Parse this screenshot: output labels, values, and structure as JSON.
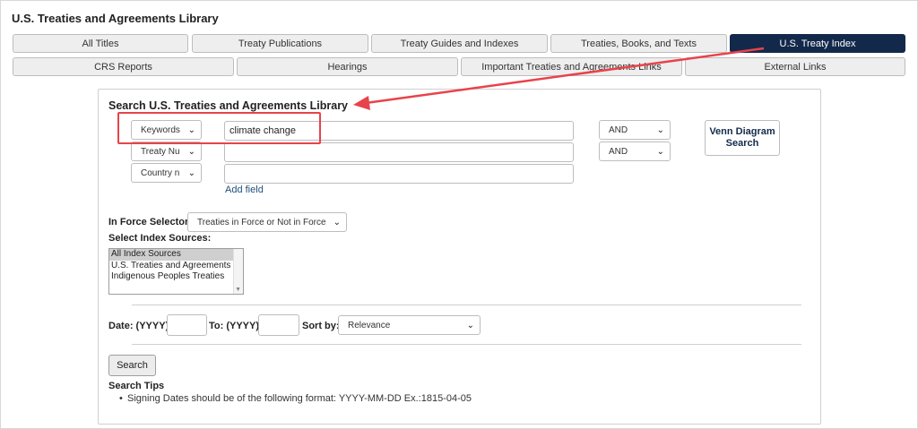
{
  "library_title": "U.S. Treaties and Agreements Library",
  "tabs_row1": [
    {
      "label": "All Titles",
      "active": false
    },
    {
      "label": "Treaty Publications",
      "active": false
    },
    {
      "label": "Treaty Guides and Indexes",
      "active": false
    },
    {
      "label": "Treaties, Books, and Texts",
      "active": false
    },
    {
      "label": "U.S. Treaty Index",
      "active": true
    }
  ],
  "tabs_row2": [
    {
      "label": "CRS Reports"
    },
    {
      "label": "Hearings"
    },
    {
      "label": "Important Treaties and Agreements Links"
    },
    {
      "label": "External Links"
    }
  ],
  "search": {
    "title": "Search U.S. Treaties and Agreements Library",
    "rows": [
      {
        "field": "Keywords",
        "value": "climate change",
        "operator": "AND"
      },
      {
        "field": "Treaty Nu",
        "value": "",
        "operator": "AND"
      },
      {
        "field": "Country n",
        "value": ""
      }
    ],
    "add_field_label": "Add field",
    "venn_button_label": "Venn Diagram Search",
    "in_force_label": "In Force Selector:",
    "in_force_value": "Treaties in Force or Not in Force",
    "index_sources_label": "Select Index Sources:",
    "index_sources": [
      {
        "label": "All Index Sources",
        "selected": true
      },
      {
        "label": "U.S. Treaties and Agreements",
        "selected": false
      },
      {
        "label": "Indigenous Peoples Treaties",
        "selected": false
      }
    ],
    "date_label": "Date: (YYYY)",
    "date_value": "",
    "to_label": "To: (YYYY)",
    "to_value": "",
    "sort_label": "Sort by:",
    "sort_value": "Relevance",
    "search_button_label": "Search",
    "tips_title": "Search Tips",
    "tips": [
      "Signing Dates should be of the following format: YYYY-MM-DD Ex.:1815-04-05"
    ]
  },
  "icons": {
    "dropdown": "chevron-down-icon",
    "listbox_scroll": "scroll-down-arrow-icon",
    "annotation": "red-arrow-annotation"
  },
  "colors": {
    "active_tab": "#13294b",
    "annotation_red": "#e8434b",
    "link": "#1f4e79"
  }
}
